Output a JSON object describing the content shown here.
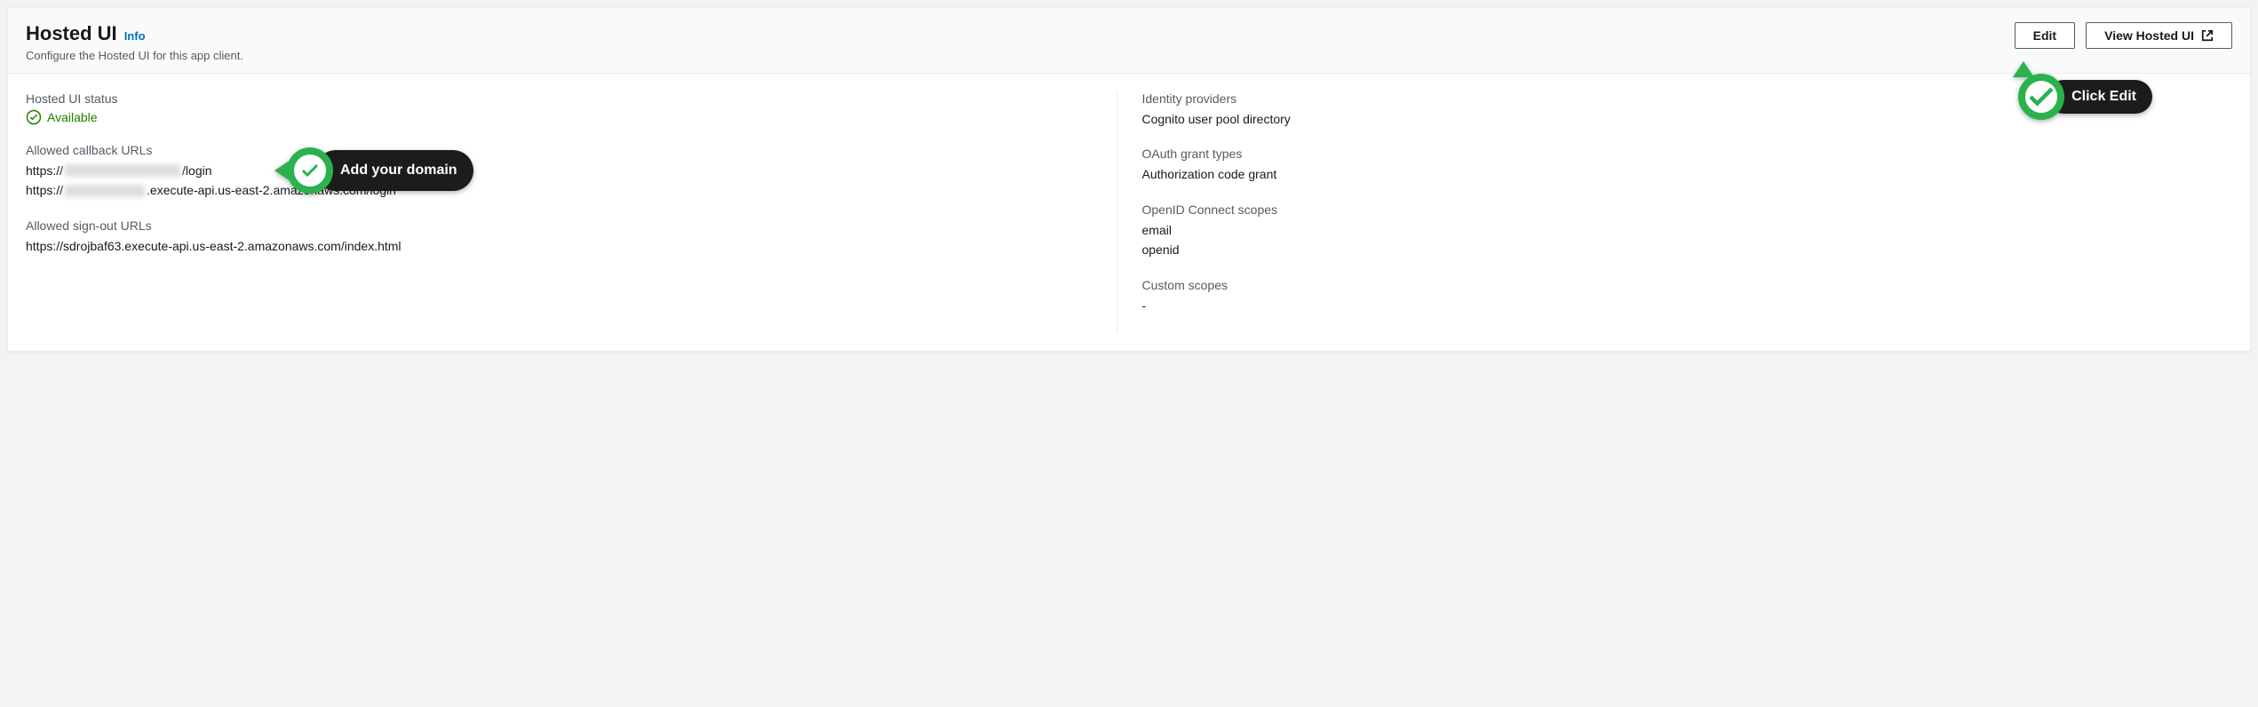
{
  "header": {
    "title": "Hosted UI",
    "info_label": "Info",
    "subtitle": "Configure the Hosted UI for this app client.",
    "edit_label": "Edit",
    "view_label": "View Hosted UI"
  },
  "annotations": {
    "add_domain": "Add your domain",
    "click_edit": "Click Edit"
  },
  "left": {
    "status_label": "Hosted UI status",
    "status_value": "Available",
    "callback_label": "Allowed callback URLs",
    "callback_urls": {
      "u1_prefix": "https://",
      "u1_suffix": "/login",
      "u2_prefix": "https://",
      "u2_suffix": ".execute-api.us-east-2.amazonaws.com/login"
    },
    "signout_label": "Allowed sign-out URLs",
    "signout_urls": [
      "https://sdrojbaf63.execute-api.us-east-2.amazonaws.com/index.html"
    ]
  },
  "right": {
    "idp_label": "Identity providers",
    "idp_value": "Cognito user pool directory",
    "grant_label": "OAuth grant types",
    "grant_value": "Authorization code grant",
    "scopes_label": "OpenID Connect scopes",
    "scopes": [
      "email",
      "openid"
    ],
    "custom_label": "Custom scopes",
    "custom_value": "-"
  }
}
